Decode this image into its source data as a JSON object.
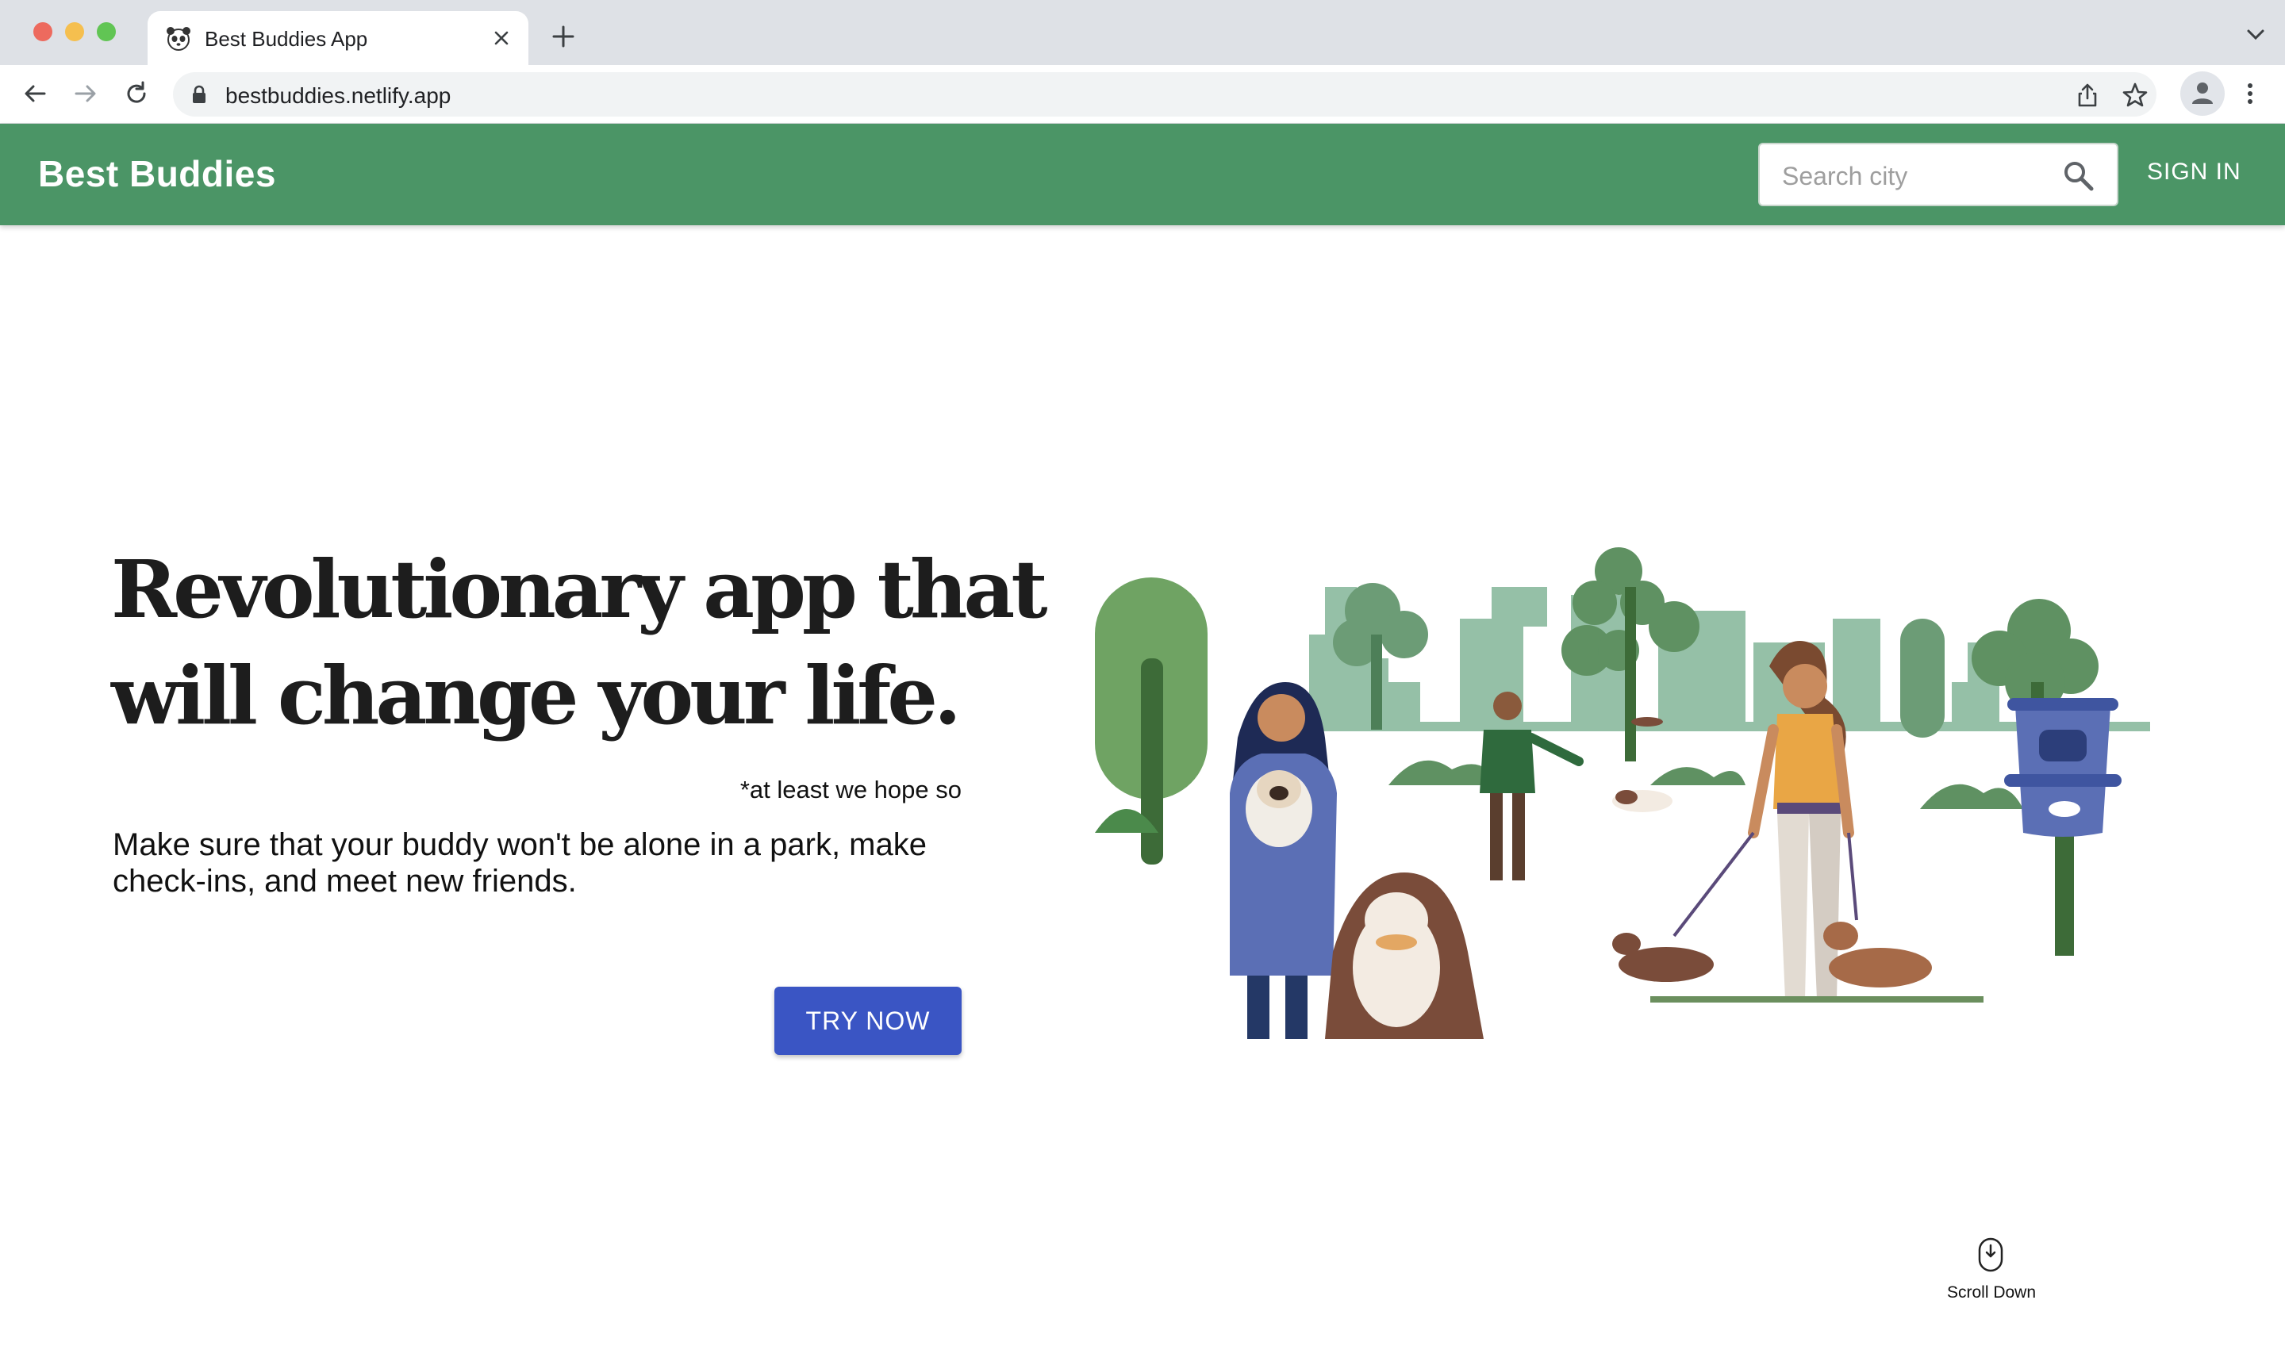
{
  "browser": {
    "tab_title": "Best Buddies App",
    "url": "bestbuddies.netlify.app"
  },
  "header": {
    "brand": "Best Buddies",
    "search_placeholder": "Search city",
    "signin_label": "SIGN IN"
  },
  "hero": {
    "headline_line1": "Revolutionary app that",
    "headline_line2": "will change your life.",
    "tagline": "*at least we hope so",
    "description": "Make sure that your buddy won't be alone in a park, make check-ins, and meet new friends.",
    "cta_label": "TRY NOW"
  },
  "scroll_hint": {
    "label": "Scroll Down"
  },
  "colors": {
    "appbar": "#4b9566",
    "cta": "#3a55c4",
    "headline": "#1d1d1d"
  },
  "icons": {
    "tab_favicon": "panda-icon",
    "search": "search-icon",
    "scroll": "mouse-icon"
  }
}
